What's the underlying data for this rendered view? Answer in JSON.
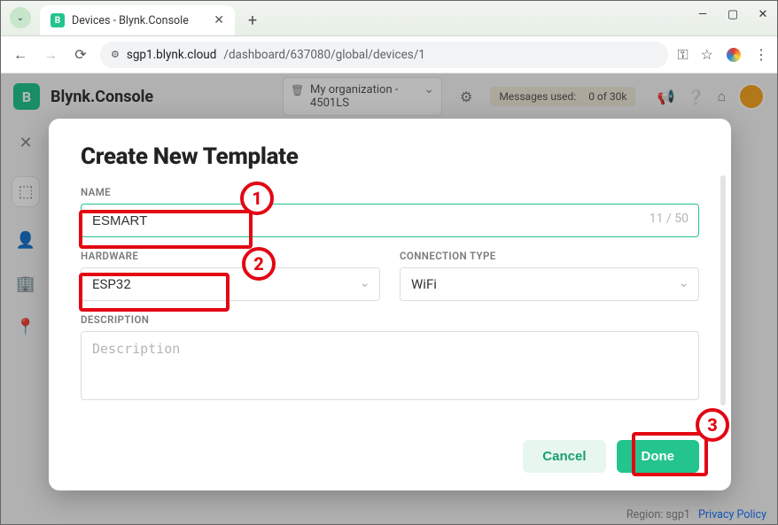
{
  "browser": {
    "tab_title": "Devices - Blynk.Console",
    "url_domain": "sgp1.blynk.cloud",
    "url_path": "/dashboard/637080/global/devices/1"
  },
  "app": {
    "brand": "Blynk.Console",
    "logo_letter": "B",
    "org_name": "My organization - 4501LS",
    "messages_label": "Messages used:",
    "messages_value": "0 of 30k"
  },
  "modal": {
    "title": "Create New Template",
    "name_label": "NAME",
    "name_value": "ESMART",
    "name_count": "11 / 50",
    "hardware_label": "HARDWARE",
    "hardware_value": "ESP32",
    "conn_label": "CONNECTION TYPE",
    "conn_value": "WiFi",
    "desc_label": "DESCRIPTION",
    "desc_placeholder": "Description",
    "cancel": "Cancel",
    "done": "Done"
  },
  "footer": {
    "region": "Region: sgp1",
    "privacy": "Privacy Policy"
  },
  "annotations": {
    "n1": "1",
    "n2": "2",
    "n3": "3"
  }
}
